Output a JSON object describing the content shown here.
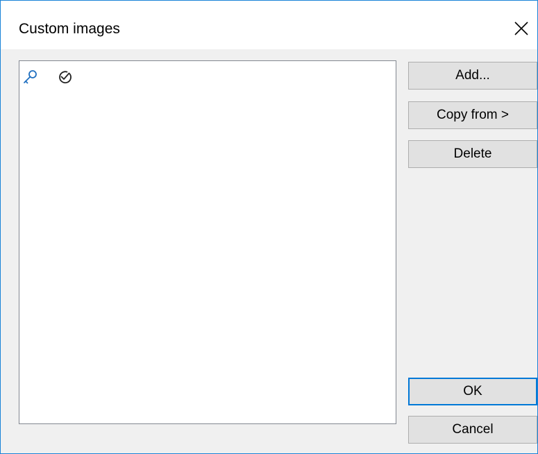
{
  "window": {
    "title": "Custom images"
  },
  "image_list": {
    "items": [
      {
        "icon": "key-icon",
        "color": "#1f6fc0"
      },
      {
        "icon": "check-circle-icon",
        "color": "#222222"
      }
    ]
  },
  "buttons": {
    "add_label": "Add...",
    "copy_from_label": "Copy from >",
    "delete_label": "Delete",
    "ok_label": "OK",
    "cancel_label": "Cancel"
  },
  "colors": {
    "accent": "#0078d7",
    "window_border": "#1883d7",
    "button_face": "#e1e1e1",
    "dialog_background": "#f0f0f0"
  }
}
